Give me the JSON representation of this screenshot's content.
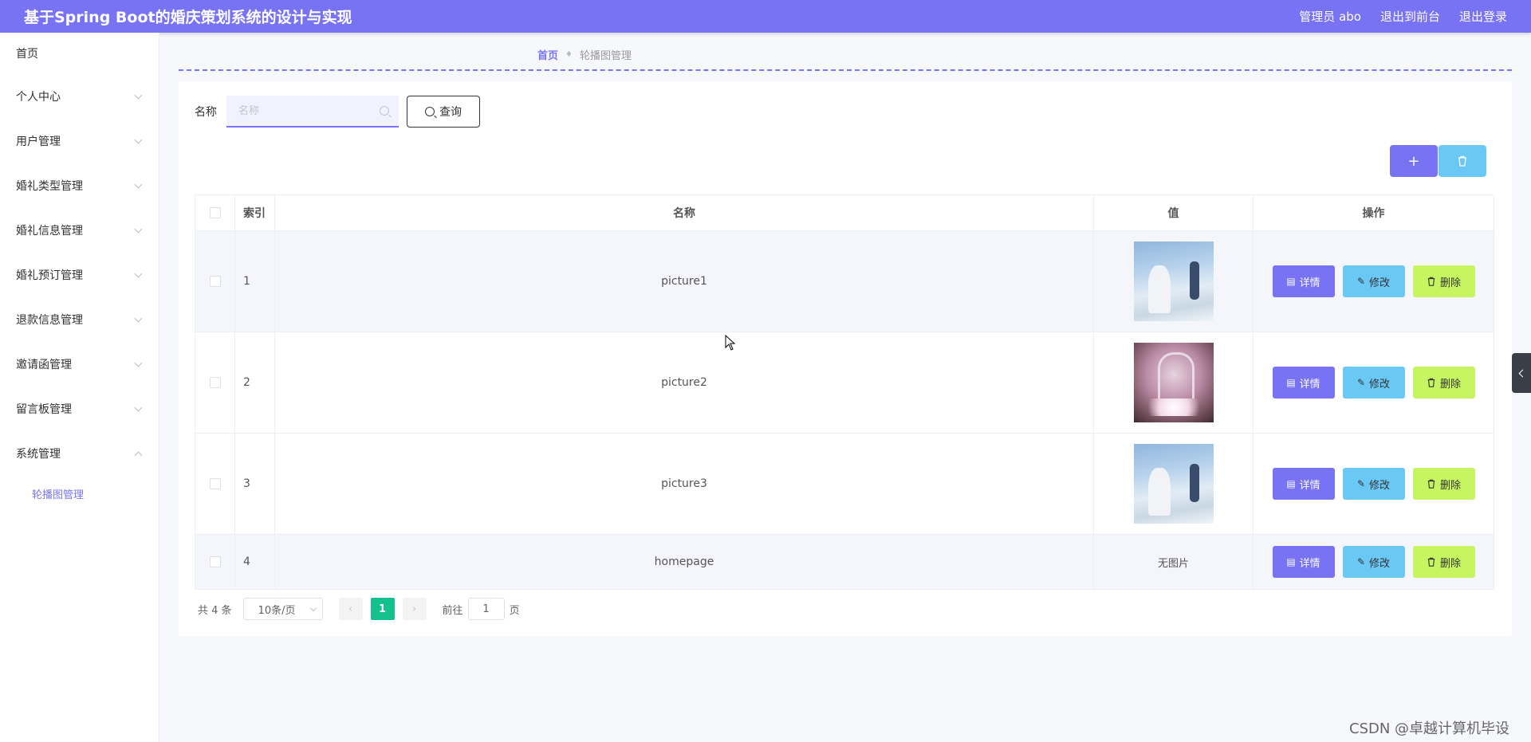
{
  "header": {
    "title": "基于Spring Boot的婚庆策划系统的设计与实现",
    "admin_label": "管理员 abo",
    "exit_front": "退出到前台",
    "logout": "退出登录"
  },
  "sidebar": {
    "items": [
      {
        "label": "首页"
      },
      {
        "label": "个人中心"
      },
      {
        "label": "用户管理"
      },
      {
        "label": "婚礼类型管理"
      },
      {
        "label": "婚礼信息管理"
      },
      {
        "label": "婚礼预订管理"
      },
      {
        "label": "退款信息管理"
      },
      {
        "label": "邀请函管理"
      },
      {
        "label": "留言板管理"
      },
      {
        "label": "系统管理"
      }
    ],
    "submenu": [
      {
        "label": "轮播图管理"
      }
    ]
  },
  "breadcrumb": {
    "home": "首页",
    "current": "轮播图管理"
  },
  "search": {
    "label": "名称",
    "placeholder": "名称",
    "button": "查询"
  },
  "toolbar": {
    "add_icon": "plus-icon",
    "delete_icon": "trash-icon"
  },
  "table": {
    "headers": {
      "index": "索引",
      "name": "名称",
      "value": "值",
      "ops": "操作"
    },
    "rows": [
      {
        "index": "1",
        "name": "picture1",
        "value_type": "image",
        "image": "wedding-photo-1"
      },
      {
        "index": "2",
        "name": "picture2",
        "value_type": "image",
        "image": "wedding-photo-2"
      },
      {
        "index": "3",
        "name": "picture3",
        "value_type": "image",
        "image": "wedding-photo-1"
      },
      {
        "index": "4",
        "name": "homepage",
        "value_type": "text",
        "value_text": "无图片"
      }
    ],
    "op_labels": {
      "detail": "详情",
      "edit": "修改",
      "delete": "删除"
    }
  },
  "pagination": {
    "total": "共 4 条",
    "page_size": "10条/页",
    "current_page": "1",
    "goto_label": "前往",
    "goto_value": "1",
    "goto_suffix": "页"
  },
  "watermark": "CSDN @卓越计算机毕设",
  "colors": {
    "primary": "#7873f5",
    "edit": "#6ac8f5",
    "delete": "#c7f561",
    "page_active": "#13c08e"
  }
}
